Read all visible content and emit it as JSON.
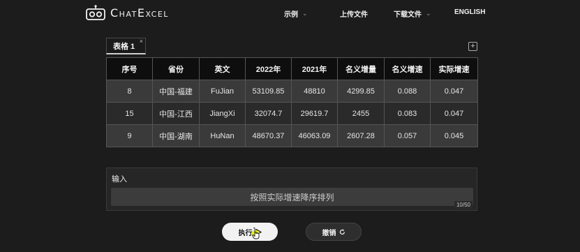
{
  "header": {
    "logo_text": "ChatExcel",
    "nav": {
      "examples": "示例",
      "upload": "上传文件",
      "download": "下载文件",
      "language": "ENGLISH"
    }
  },
  "sheet": {
    "tab_label": "表格 1",
    "tab_close": "×",
    "add_label": "+"
  },
  "table": {
    "headers": [
      "序号",
      "省份",
      "英文",
      "2022年",
      "2021年",
      "名义增量",
      "名义增速",
      "实际增速"
    ],
    "rows": [
      [
        "8",
        "中国-福建",
        "FuJian",
        "53109.85",
        "48810",
        "4299.85",
        "0.088",
        "0.047"
      ],
      [
        "15",
        "中国-江西",
        "JiangXi",
        "32074.7",
        "29619.7",
        "2455",
        "0.083",
        "0.047"
      ],
      [
        "9",
        "中国-湖南",
        "HuNan",
        "48670.37",
        "46063.09",
        "2607.28",
        "0.057",
        "0.045"
      ]
    ]
  },
  "input": {
    "label": "输入",
    "value": "按照实际增速降序排列",
    "counter": "10/50"
  },
  "buttons": {
    "execute": "执行",
    "undo": "撤销"
  },
  "colors": {
    "background": "#1c1c1c",
    "header_row": "#0e0e0e",
    "row_light": "#3a3a3a",
    "row_dark": "#2a2a2a",
    "cursor": "#e8f000"
  }
}
